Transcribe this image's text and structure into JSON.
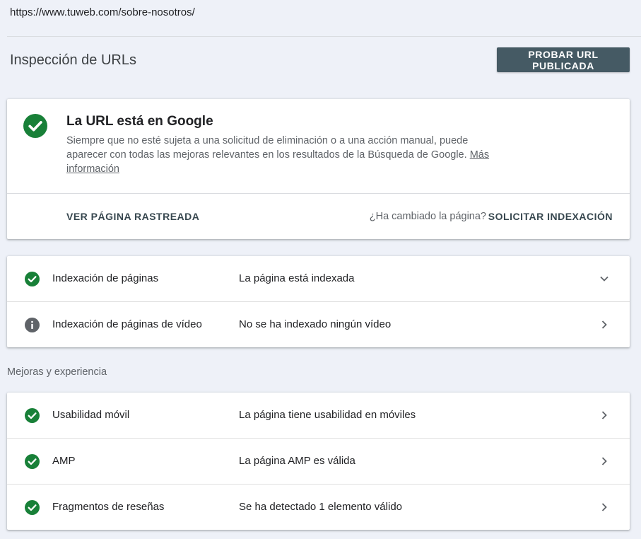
{
  "url": "https://www.tuweb.com/sobre-nosotros/",
  "header": {
    "title": "Inspección de URLs",
    "live_test_button": "PROBAR URL PUBLICADA"
  },
  "status": {
    "icon": "check-circle-icon",
    "color": "#188038",
    "title": "La URL está en Google",
    "description": "Siempre que no esté sujeta a una solicitud de eliminación o a una acción manual, puede aparecer con todas las mejoras relevantes en los resultados de la Búsqueda de Google.",
    "learn_more": "Más información",
    "view_crawled": "VER PÁGINA RASTREADA",
    "changed_question": "¿Ha cambiado la página?",
    "request_indexing": "SOLICITAR INDEXACIÓN"
  },
  "indexing": [
    {
      "icon": "check-circle-icon",
      "label": "Indexación de páginas",
      "value": "La página está indexada",
      "chevron": "chevron-down-icon"
    },
    {
      "icon": "info-icon",
      "label": "Indexación de páginas de vídeo",
      "value": "No se ha indexado ningún vídeo",
      "chevron": "chevron-right-icon"
    }
  ],
  "enhancements": {
    "section_label": "Mejoras y experiencia",
    "items": [
      {
        "icon": "check-circle-icon",
        "label": "Usabilidad móvil",
        "value": "La página tiene usabilidad en móviles",
        "chevron": "chevron-right-icon"
      },
      {
        "icon": "check-circle-icon",
        "label": "AMP",
        "value": "La página AMP es válida",
        "chevron": "chevron-right-icon"
      },
      {
        "icon": "check-circle-icon",
        "label": "Fragmentos de reseñas",
        "value": "Se ha detectado 1 elemento válido",
        "chevron": "chevron-right-icon"
      }
    ]
  }
}
